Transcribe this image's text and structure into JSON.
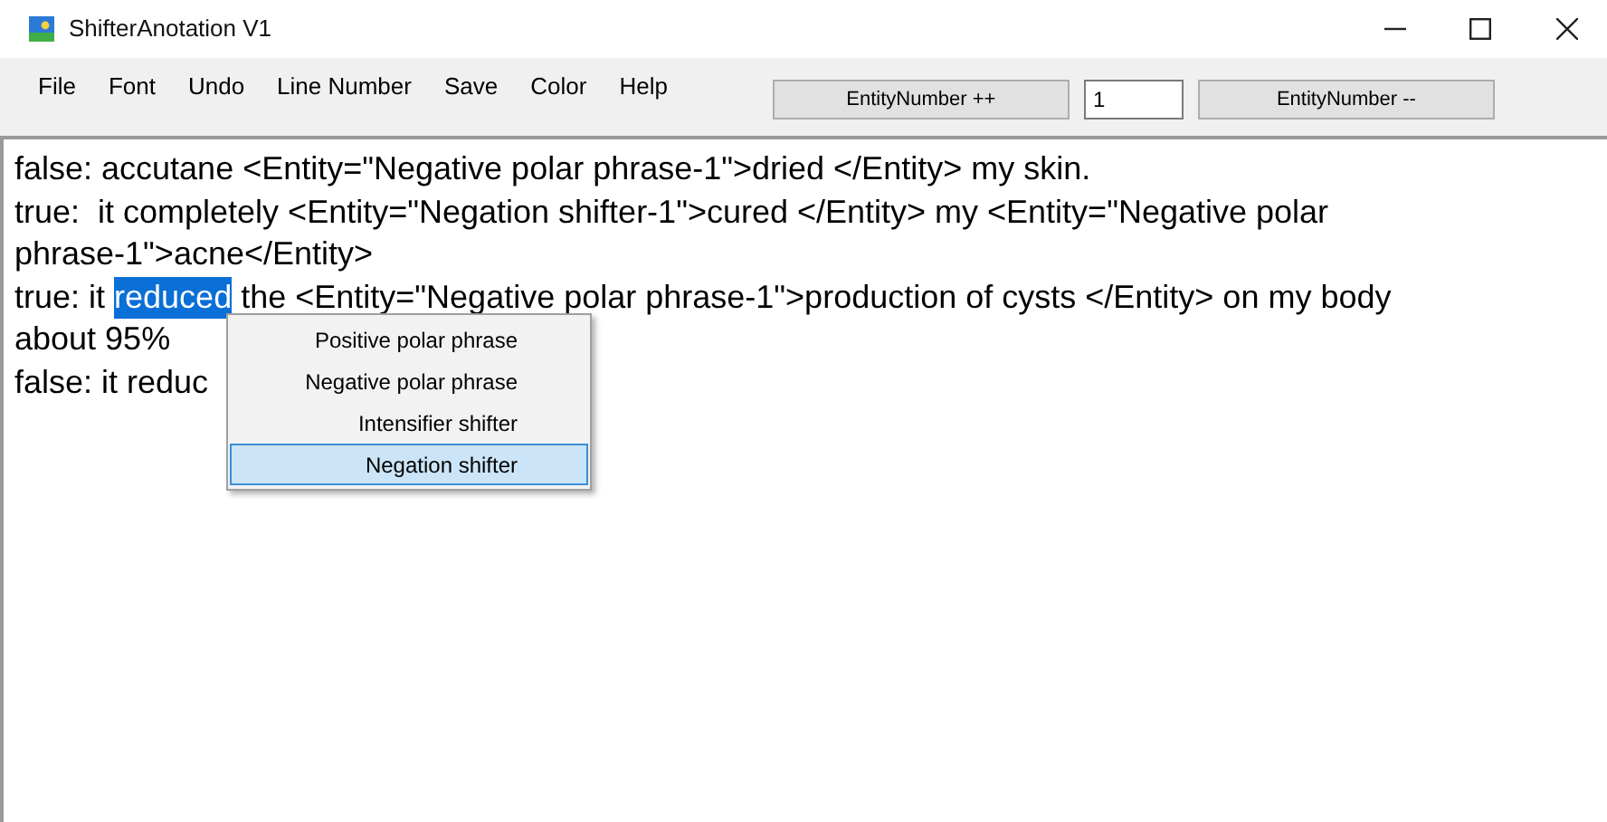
{
  "window": {
    "title": "ShifterAnotation V1"
  },
  "menu": [
    "File",
    "Font",
    "Undo",
    "Line Number",
    "Save",
    "Color",
    "Help"
  ],
  "toolbar": {
    "increment_button": "EntityNumber ++",
    "entity_number": "1",
    "decrement_button": "EntityNumber --"
  },
  "editor": {
    "lines": [
      {
        "segments": [
          {
            "text": "false: accutane <Entity=\"Negative polar phrase-1\">dried </Entity> my skin.",
            "selected": false
          }
        ]
      },
      {
        "segments": [
          {
            "text": "true:  it completely <Entity=\"Negation shifter-1\">cured </Entity> my <Entity=\"Negative polar",
            "selected": false
          }
        ]
      },
      {
        "segments": [
          {
            "text": "phrase-1\">acne</Entity>",
            "selected": false
          }
        ]
      },
      {
        "segments": [
          {
            "text": "true: it ",
            "selected": false
          },
          {
            "text": "reduced",
            "selected": true
          },
          {
            "text": " the <Entity=\"Negative polar phrase-1\">production of cysts </Entity> on my body",
            "selected": false
          }
        ]
      },
      {
        "segments": [
          {
            "text": "about 95%",
            "selected": false
          }
        ]
      },
      {
        "segments": [
          {
            "text": "false: it reduc",
            "selected": false
          }
        ]
      }
    ]
  },
  "context_menu": [
    {
      "label": "Positive polar phrase",
      "selected": false
    },
    {
      "label": "Negative polar phrase",
      "selected": false
    },
    {
      "label": "Intensifier shifter",
      "selected": false
    },
    {
      "label": "Negation shifter",
      "selected": true
    }
  ]
}
